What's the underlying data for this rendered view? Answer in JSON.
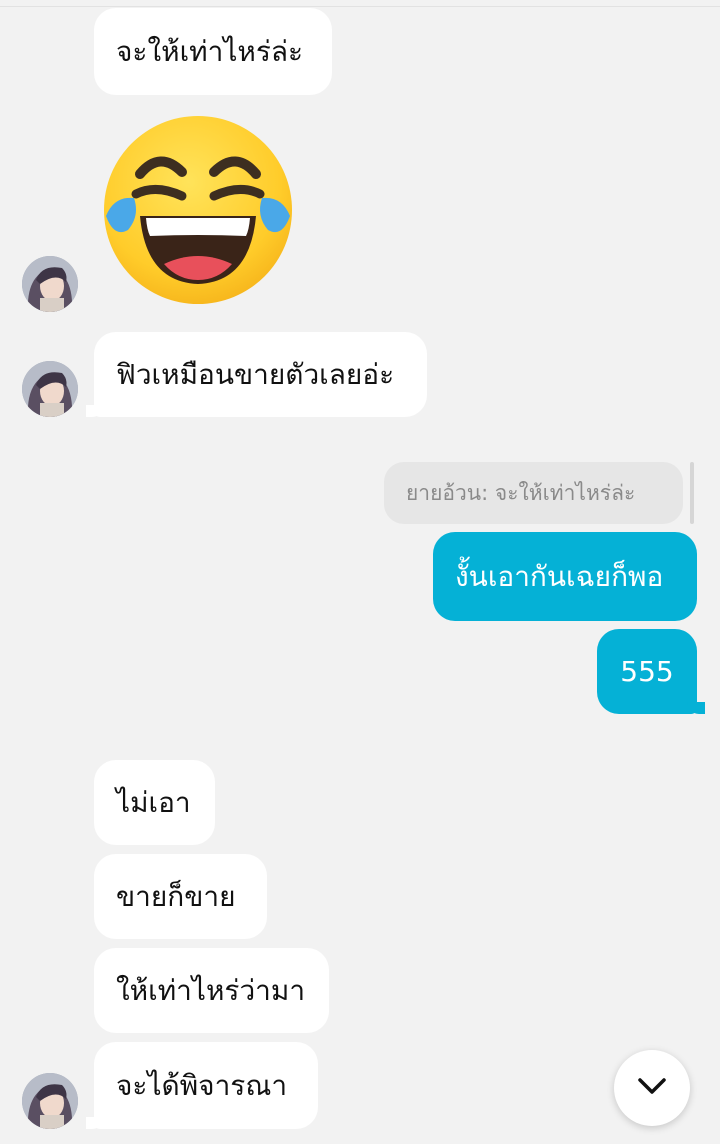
{
  "messages": {
    "m1": "จะให้เท่าไหร่ล่ะ",
    "m2": "ฟิวเหมือนขายตัวเลยอ่ะ",
    "reply_quote": "ยายอ้วน: จะให้เท่าไหร่ล่ะ",
    "m3": "งั้นเอากันเฉยก็พอ",
    "m4": "555",
    "m5": "ไม่เอา",
    "m6": "ขายก็ขาย",
    "m7": "ให้เท่าไหร่ว่ามา",
    "m8": "จะได้พิจารณา"
  },
  "emoji": "laughing-with-tears-emoji",
  "icons": {
    "scroll_down": "chevron-down-icon"
  },
  "colors": {
    "background": "#f2f2f2",
    "incoming_bubble": "#ffffff",
    "outgoing_bubble": "#05b1d6",
    "reply_quote_bg": "#e6e6e6"
  }
}
